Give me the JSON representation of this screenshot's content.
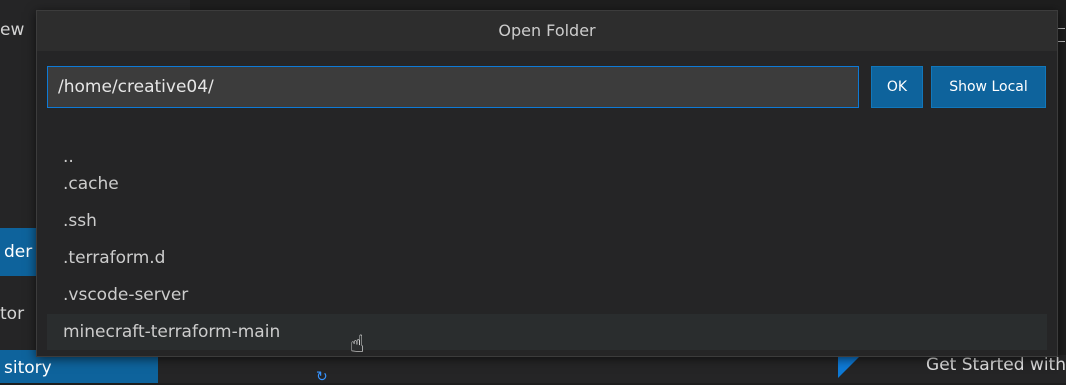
{
  "background": {
    "menu_fragment": "ew",
    "sidebar_fragments": [
      "der",
      "tor"
    ],
    "repository_button": "sitory",
    "get_started": "Get Started with"
  },
  "dialog": {
    "title": "Open Folder",
    "path_value": "/home/creative04/",
    "ok_label": "OK",
    "show_local_label": "Show Local",
    "items": [
      "..",
      ".cache",
      ".ssh",
      ".terraform.d",
      ".vscode-server",
      "minecraft-terraform-main"
    ],
    "hovered_index": 5
  }
}
